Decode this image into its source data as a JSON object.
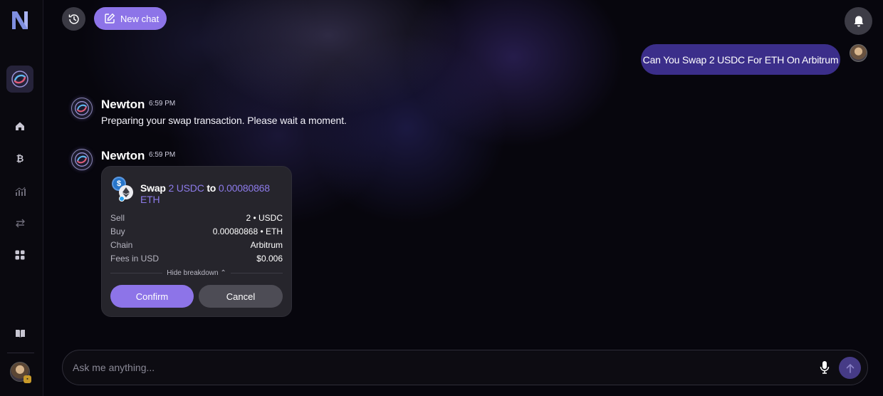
{
  "app": {
    "colors": {
      "accent": "#8d74e8",
      "user_bubble": "#3b2e8a",
      "card": "#26252c",
      "highlight_text": "#8d7bea"
    }
  },
  "sidebar": {
    "logo_icon": "newton-logo-icon",
    "agent_icon": "newton-orb-icon",
    "items": [
      {
        "name": "home",
        "icon": "home-icon"
      },
      {
        "name": "bitcoin",
        "icon": "bitcoin-icon"
      },
      {
        "name": "analytics",
        "icon": "chart-icon"
      },
      {
        "name": "swap",
        "icon": "swap-arrows-icon"
      },
      {
        "name": "apps",
        "icon": "grid-icon"
      },
      {
        "name": "docs",
        "icon": "book-icon"
      }
    ]
  },
  "header": {
    "new_chat_label": "New chat"
  },
  "chat": {
    "user_message": "Can You Swap 2 USDC For ETH On Arbitrum",
    "messages": [
      {
        "sender": "Newton",
        "time": "6:59 PM",
        "text": "Preparing your swap transaction. Please wait a moment."
      },
      {
        "sender": "Newton",
        "time": "6:59 PM"
      }
    ]
  },
  "swap": {
    "title_word": "Swap",
    "from_amount": "2 USDC",
    "to_word": "to",
    "to_amount": "0.00080868 ETH",
    "token_from_symbol": "$",
    "rows": [
      {
        "label": "Sell",
        "value": "2 • USDC"
      },
      {
        "label": "Buy",
        "value": "0.00080868 • ETH"
      },
      {
        "label": "Chain",
        "value": "Arbitrum"
      },
      {
        "label": "Fees in USD",
        "value": "$0.006"
      }
    ],
    "breakdown_label": "Hide breakdown ⌃",
    "confirm_label": "Confirm",
    "cancel_label": "Cancel"
  },
  "composer": {
    "placeholder": "Ask me anything..."
  }
}
